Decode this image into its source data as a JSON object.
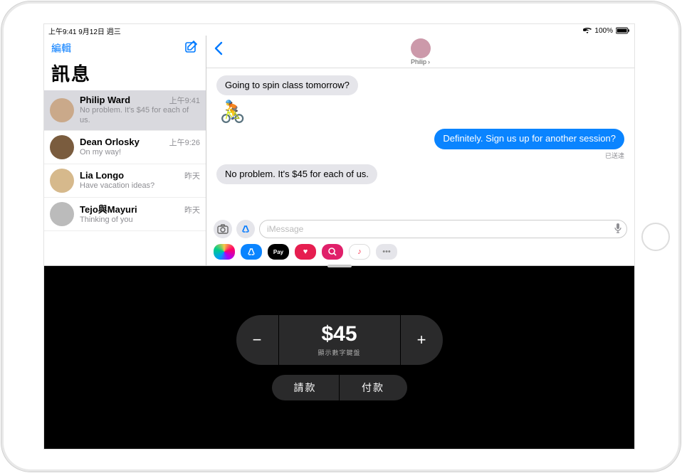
{
  "statusbar": {
    "left": "上午9:41  9月12日 週三",
    "battery": "100%"
  },
  "sidebar": {
    "edit_label": "編輯",
    "title": "訊息",
    "conversations": [
      {
        "name": "Philip Ward",
        "time": "上午9:41",
        "preview": "No problem. It's $45 for each of us."
      },
      {
        "name": "Dean Orlosky",
        "time": "上午9:26",
        "preview": "On my way!"
      },
      {
        "name": "Lia Longo",
        "time": "昨天",
        "preview": "Have vacation ideas?"
      },
      {
        "name": "Tejo與Mayuri",
        "time": "昨天",
        "preview": "Thinking of you"
      }
    ]
  },
  "chat": {
    "contact_name": "Philip",
    "messages": {
      "in1": "Going to spin class tomorrow?",
      "emoji": "🚴",
      "out1": "Definitely. Sign us up for another session?",
      "delivered": "已送達",
      "in2": "No problem. It's $45 for each of us."
    },
    "input_placeholder": "iMessage"
  },
  "paypanel": {
    "amount": "$45",
    "keypad_hint": "顯示數字鍵盤",
    "request_label": "請款",
    "pay_label": "付款"
  }
}
